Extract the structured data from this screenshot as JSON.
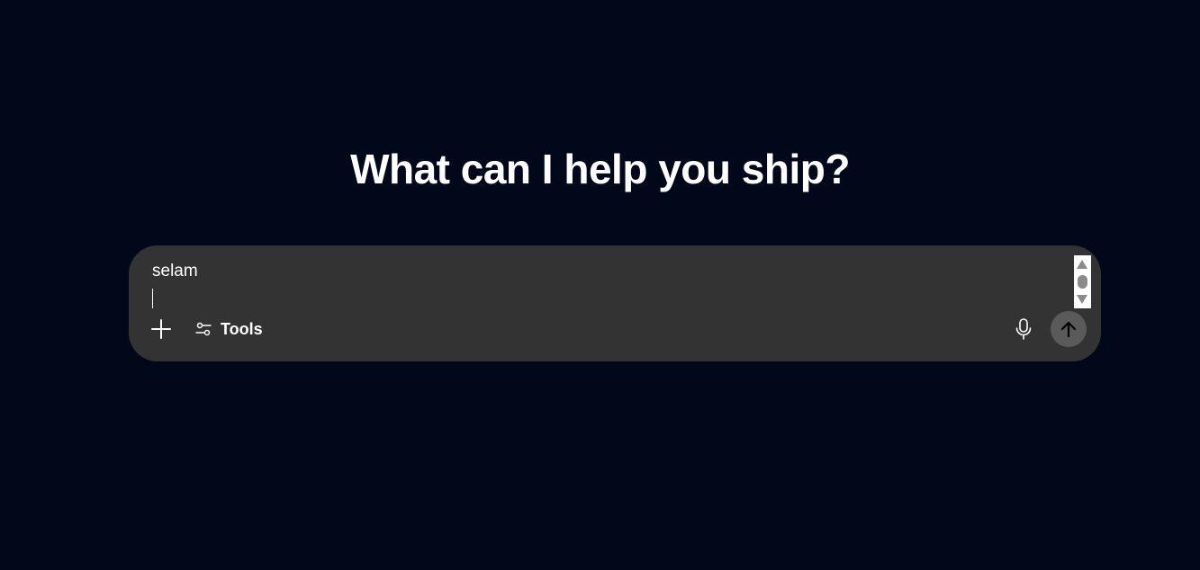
{
  "page": {
    "headline": "What can I help you ship?"
  },
  "composer": {
    "input_value": "selam",
    "tools_label": "Tools",
    "icons": {
      "add": "plus-icon",
      "tools": "sliders-icon",
      "voice": "microphone-icon",
      "send": "arrow-up-icon"
    }
  },
  "colors": {
    "background": "#00081a",
    "composer_background": "#333333",
    "send_button": "#5a5a5a",
    "text": "#ffffff"
  }
}
